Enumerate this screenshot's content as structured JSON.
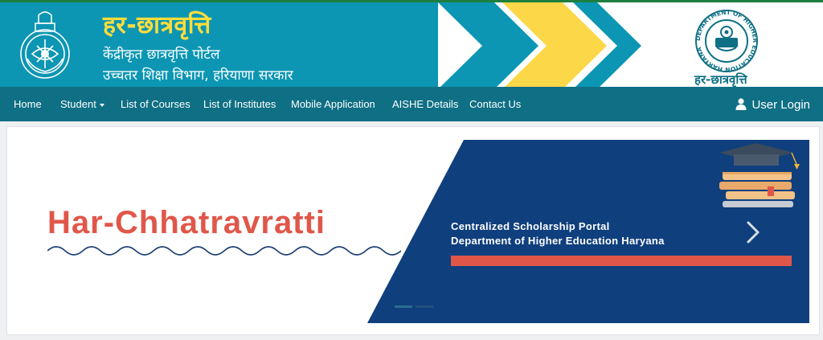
{
  "header": {
    "title": "हर-छात्रवृत्ति",
    "subtitle_line1": "केंद्रीकृत छात्रवृत्ति पोर्टल",
    "subtitle_line2": "उच्चतर शिक्षा विभाग, हरियाणा सरकार",
    "emblem_icon": "state-emblem-icon",
    "dept_logo": {
      "icon": "department-logo-icon",
      "caption": "हर-छात्रवृत्ति",
      "ring_text": "DEPARTMENT OF HIGHER EDUCATION HARYANA"
    },
    "colors": {
      "teal": "#0c96b3",
      "title": "#ffdd3c",
      "chevron": "#fcd849"
    }
  },
  "nav": {
    "items": [
      {
        "label": "Home"
      },
      {
        "label": "Student",
        "has_dropdown": true
      },
      {
        "label": "List of Courses"
      },
      {
        "label": "List of Institutes"
      },
      {
        "label": "Mobile Application"
      },
      {
        "label": "AISHE Details"
      },
      {
        "label": "Contact Us"
      }
    ],
    "login_label": "User Login",
    "login_icon": "user-icon",
    "colors": {
      "background": "#0f6f84"
    }
  },
  "banner": {
    "heading": "Har-Chhatravratti",
    "line1": "Centralized Scholarship Portal",
    "line2": "Department of Higher Education Haryana",
    "next_icon": "chevron-right-icon",
    "illustration_icon": "graduation-books-icon",
    "slide_count": 2,
    "active_slide": 1,
    "colors": {
      "heading": "#e0574a",
      "panel": "#0f3f7d",
      "bar": "#e0574a"
    }
  }
}
